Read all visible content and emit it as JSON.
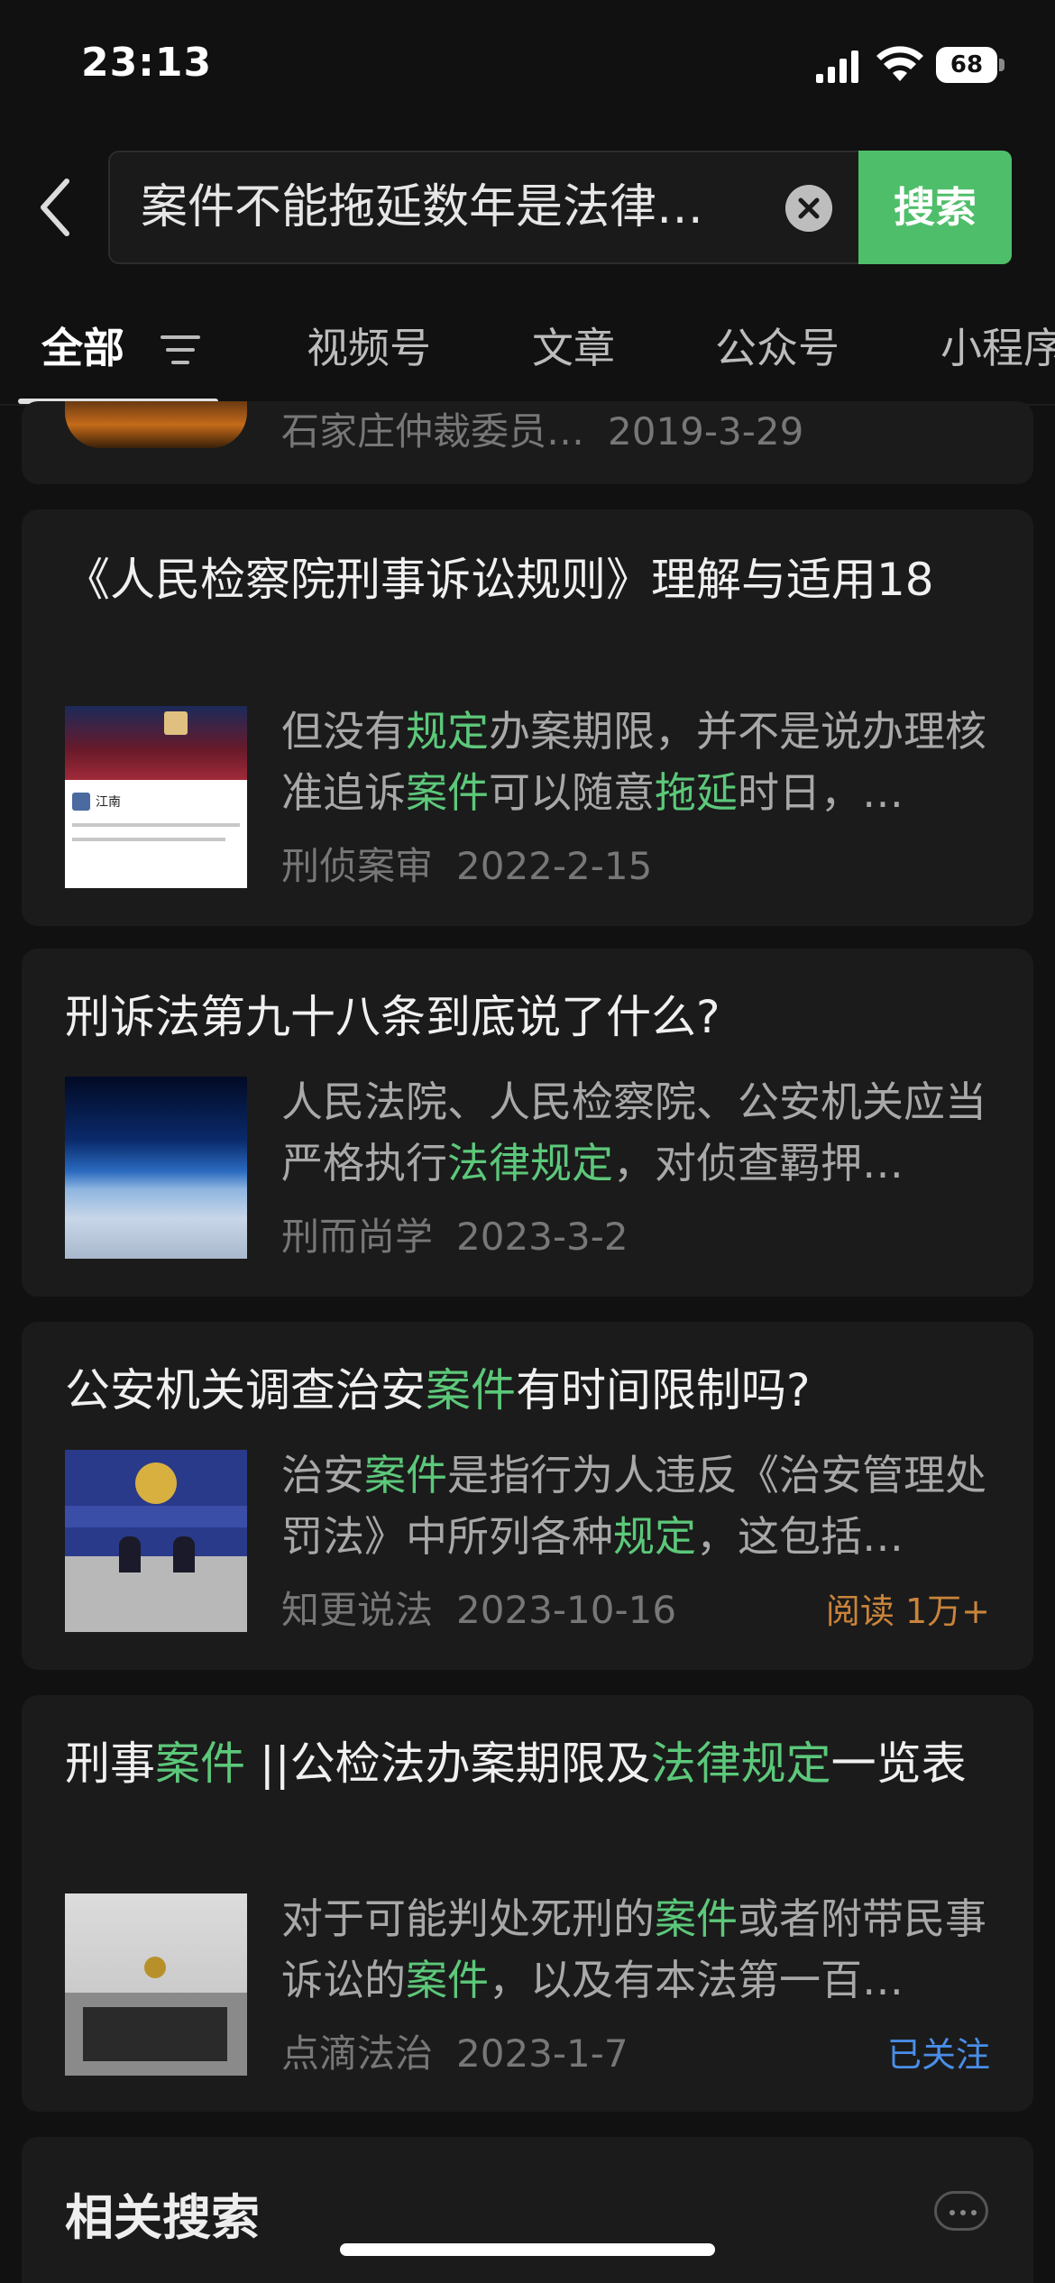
{
  "status_bar": {
    "time": "23:13",
    "battery": "68"
  },
  "search": {
    "query": "案件不能拖延数年是法律…",
    "button_label": "搜索"
  },
  "tabs": [
    {
      "label": "全部"
    },
    {
      "label": "视频号"
    },
    {
      "label": "文章"
    },
    {
      "label": "公众号"
    },
    {
      "label": "小程序"
    }
  ],
  "partial_card": {
    "source": "石家庄仲裁委员…",
    "date": "2019-3-29"
  },
  "results": [
    {
      "title": "《人民检察院刑事诉讼规则》理解与适用18",
      "snippet_parts": [
        "但没有",
        "规定",
        "办案期限，并不是说办理核准追诉",
        "案件",
        "可以随意",
        "拖延",
        "时日，…"
      ],
      "source": "刑侦案审",
      "date": "2022-2-15",
      "thumbnail_icon": "red-tree-thumbnail",
      "thumb_name": "江南"
    },
    {
      "title": "刑诉法第九十八条到底说了什么?",
      "snippet_parts": [
        "人民法院、人民检察院、公安机关应当严格执行",
        "法律规定",
        "，对侦查羁押…"
      ],
      "source": "刑而尚学",
      "date": "2023-3-2",
      "thumbnail_icon": "earth-horizon-thumbnail"
    },
    {
      "title_parts": [
        "公安机关调查治安",
        "案件",
        "有时间限制吗?"
      ],
      "snippet_parts": [
        "治安",
        "案件",
        "是指行为人违反《治安管理处罚法》中所列各种",
        "规定",
        "，这包括…"
      ],
      "source": "知更说法",
      "date": "2023-10-16",
      "extra": "阅读 1万+",
      "extra_color": "#c9843a",
      "thumbnail_icon": "police-press-thumbnail"
    },
    {
      "title_parts": [
        "刑事",
        "案件",
        " ||公检法办案期限及",
        "法律规定",
        "一览表"
      ],
      "snippet_parts": [
        "对于可能判处死刑的",
        "案件",
        "或者附带民事诉讼的",
        "案件",
        "，以及有本法第一百…"
      ],
      "source": "点滴法治",
      "date": "2023-1-7",
      "extra": "已关注",
      "extra_color": "#4a8ee8",
      "thumbnail_icon": "court-building-thumbnail"
    }
  ],
  "related": {
    "title": "相关搜索"
  },
  "colors": {
    "highlight": "#5cc87a",
    "search_button": "#4fbe6a",
    "background": "#111111",
    "card": "#1b1b1b"
  }
}
